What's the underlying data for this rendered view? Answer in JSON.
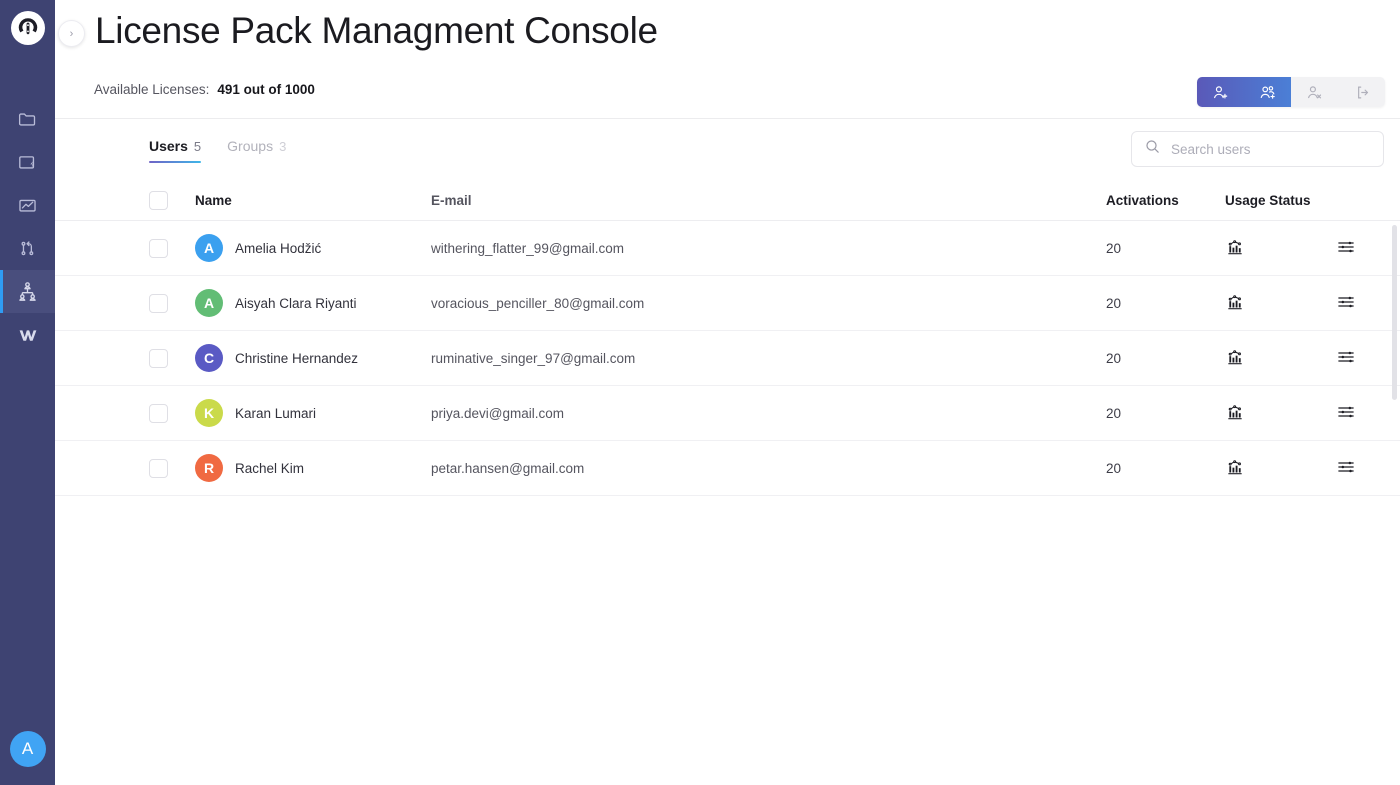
{
  "sidebar": {
    "logo_name": "omega-logo",
    "items": [
      {
        "name": "folder-icon",
        "label": "Projects",
        "active": false
      },
      {
        "name": "window-bolt-icon",
        "label": "Automation",
        "active": false
      },
      {
        "name": "chart-line-icon",
        "label": "Analytics",
        "active": false
      },
      {
        "name": "branch-icon",
        "label": "Workflows",
        "active": false
      },
      {
        "name": "users-group-icon",
        "label": "Licenses",
        "active": true
      },
      {
        "name": "w-logo-icon",
        "label": "Workspace",
        "active": false
      }
    ],
    "account_avatar": {
      "initial": "A",
      "color": "#40a4f4"
    }
  },
  "header": {
    "collapse_icon": "chevron-right-icon",
    "title": "License Pack Managment Console",
    "license_label": "Available Licenses:",
    "license_value": "491 out of 1000",
    "actions": [
      {
        "name": "add-user-button",
        "icon": "user-plus-icon",
        "enabled": true
      },
      {
        "name": "add-group-button",
        "icon": "users-plus-icon",
        "enabled": true
      },
      {
        "name": "remove-user-button",
        "icon": "user-remove-icon",
        "enabled": false
      },
      {
        "name": "export-button",
        "icon": "sign-out-icon",
        "enabled": false
      }
    ]
  },
  "tabs": [
    {
      "label": "Users",
      "count": "5",
      "active": true
    },
    {
      "label": "Groups",
      "count": "3",
      "active": false
    }
  ],
  "search": {
    "placeholder": "Search users",
    "value": "",
    "icon": "search-icon"
  },
  "table": {
    "columns": {
      "name": "Name",
      "email": "E-mail",
      "activations": "Activations",
      "usage_status": "Usage Status"
    },
    "rows": [
      {
        "initial": "A",
        "color": "#3ba0ef",
        "name": "Amelia Hodžić",
        "email": "withering_flatter_99@gmail.com",
        "activations": "20",
        "usage_icon": "bar-chart-icon",
        "menu_icon": "row-settings-icon"
      },
      {
        "initial": "A",
        "color": "#62bd75",
        "name": "Aisyah Clara Riyanti",
        "email": "voracious_penciller_80@gmail.com",
        "activations": "20",
        "usage_icon": "bar-chart-icon",
        "menu_icon": "row-settings-icon"
      },
      {
        "initial": "C",
        "color": "#5a5ac4",
        "name": "Christine Hernandez",
        "email": "ruminative_singer_97@gmail.com",
        "activations": "20",
        "usage_icon": "bar-chart-icon",
        "menu_icon": "row-settings-icon"
      },
      {
        "initial": "K",
        "color": "#cada4a",
        "name": "Karan Lumari",
        "email": "priya.devi@gmail.com",
        "activations": "20",
        "usage_icon": "bar-chart-icon",
        "menu_icon": "row-settings-icon"
      },
      {
        "initial": "R",
        "color": "#f06a42",
        "name": "Rachel Kim",
        "email": "petar.hansen@gmail.com",
        "activations": "20",
        "usage_icon": "bar-chart-icon",
        "menu_icon": "row-settings-icon"
      }
    ]
  },
  "colors": {
    "sidebar_bg": "#3e4372",
    "sidebar_active_bg": "#494e7d",
    "sidebar_active_indicator": "#2f9cf4",
    "primary_gradient_start": "#5a59b8",
    "primary_gradient_end": "#4b7fd6",
    "tab_underline_start": "#6f63c6",
    "tab_underline_end": "#3fb6e8"
  }
}
